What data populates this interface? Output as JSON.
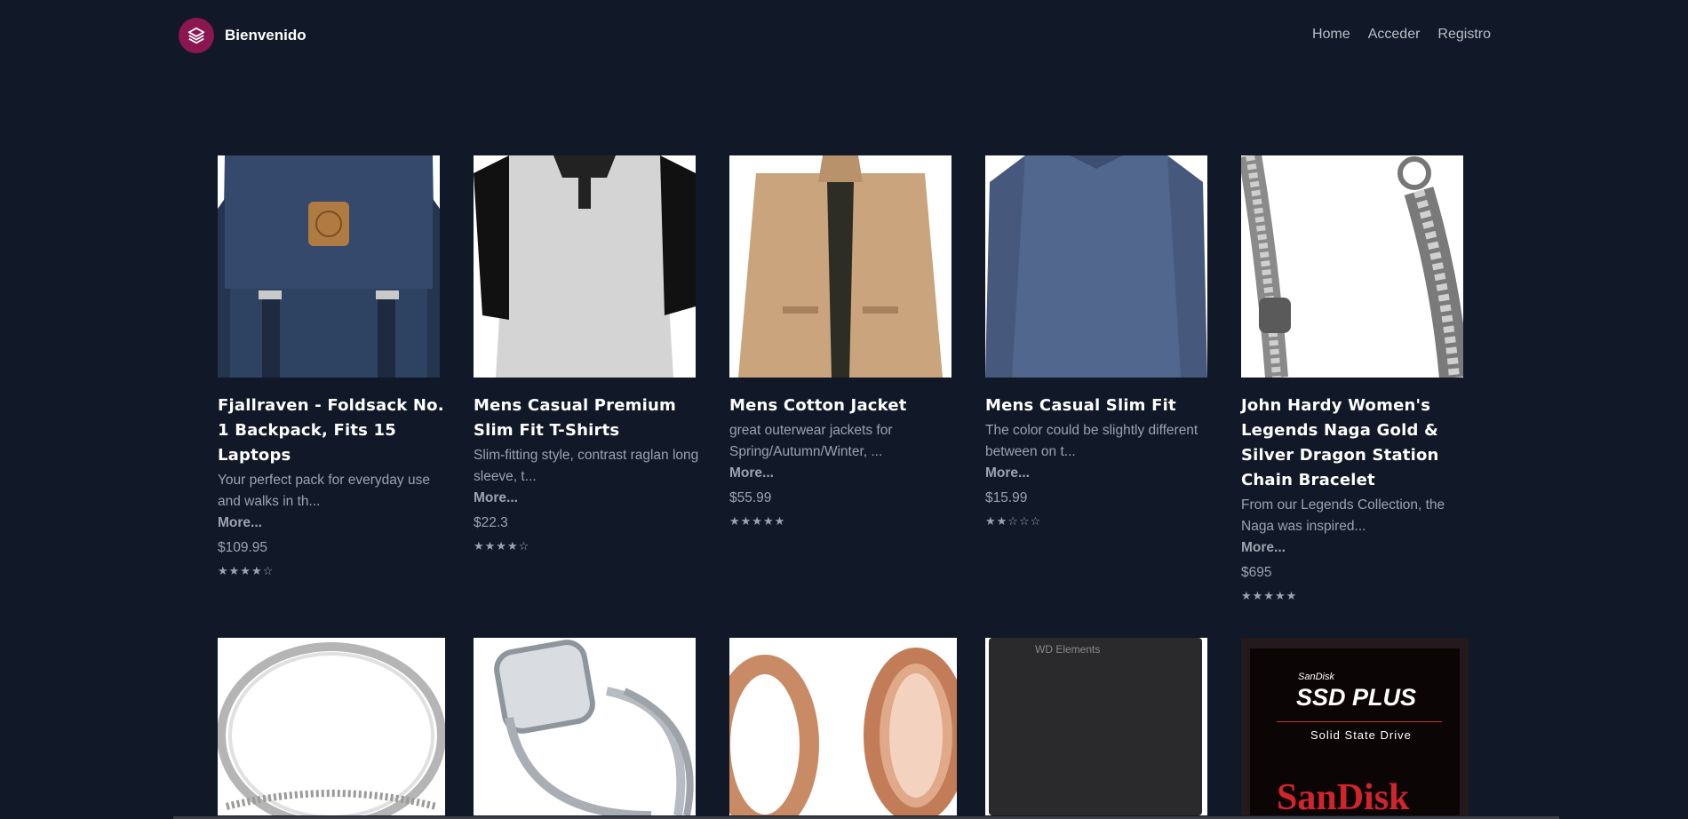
{
  "brand": {
    "name": "Bienvenido"
  },
  "nav": {
    "items": [
      "Home",
      "Acceder",
      "Registro"
    ]
  },
  "products_row1": [
    {
      "title": "Fjallraven - Foldsack No. 1 Backpack, Fits 15 Laptops",
      "desc": "Your perfect pack for everyday use and walks in th...",
      "more": "More...",
      "price": "$109.95",
      "stars": "★★★★☆"
    },
    {
      "title": "Mens Casual Premium Slim Fit T-Shirts",
      "desc": "Slim-fitting style, contrast raglan long sleeve, t...",
      "more": "More...",
      "price": "$22.3",
      "stars": "★★★★☆"
    },
    {
      "title": "Mens Cotton Jacket",
      "desc": "great outerwear jackets for Spring/Autumn/Winter, ...",
      "more": "More...",
      "price": "$55.99",
      "stars": "★★★★★"
    },
    {
      "title": "Mens Casual Slim Fit",
      "desc": "The color could be slightly different between on t...",
      "more": "More...",
      "price": "$15.99",
      "stars": "★★☆☆☆"
    },
    {
      "title": "John Hardy Women's Legends Naga Gold & Silver Dragon Station Chain Bracelet",
      "desc": "From our Legends Collection, the Naga was inspired...",
      "more": "More...",
      "price": "$695",
      "stars": "★★★★★"
    }
  ],
  "row2_images": {
    "hdd_label": "WD Elements",
    "ssd_brand_small": "SanDisk",
    "ssd_title": "SSD PLUS",
    "ssd_sub": "Solid State Drive",
    "ssd_brand_big": "SanDisk"
  },
  "colors": {
    "background": "#111827",
    "brand_logo": "#8b1650",
    "muted_text": "#9ca3af"
  }
}
